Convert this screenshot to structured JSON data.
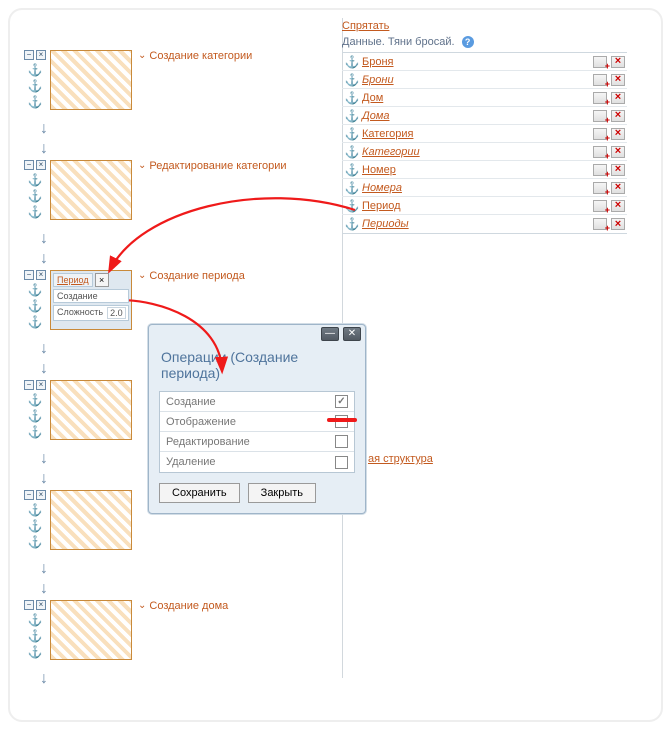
{
  "left_blocks": [
    {
      "label": "Создание категории"
    },
    {
      "label": "Редактирование категории"
    },
    {
      "label": "Создание периода",
      "tag": "Период",
      "field": "Создание",
      "prop_label": "Сложность",
      "prop_val": "2.0"
    },
    {
      "label": ""
    },
    {
      "label": ""
    },
    {
      "label": "Создание дома"
    }
  ],
  "right": {
    "hide": "Спрятать",
    "heading": "Данные. Тяни бросай.",
    "rows": [
      {
        "label": "Броня",
        "italic": false
      },
      {
        "label": "Брони",
        "italic": true
      },
      {
        "label": "Дом",
        "italic": false
      },
      {
        "label": "Дома",
        "italic": true
      },
      {
        "label": "Категория",
        "italic": false
      },
      {
        "label": "Категории",
        "italic": true
      },
      {
        "label": "Номер",
        "italic": false
      },
      {
        "label": "Номера",
        "italic": true
      },
      {
        "label": "Период",
        "italic": false
      },
      {
        "label": "Периоды",
        "italic": true
      }
    ],
    "footer": "ая структура"
  },
  "dialog": {
    "title": "Операции (Создание периода)",
    "ops": [
      {
        "label": "Создание",
        "checked": true
      },
      {
        "label": "Отображение",
        "checked": false
      },
      {
        "label": "Редактирование",
        "checked": false
      },
      {
        "label": "Удаление",
        "checked": false
      }
    ],
    "save": "Сохранить",
    "close": "Закрыть"
  }
}
